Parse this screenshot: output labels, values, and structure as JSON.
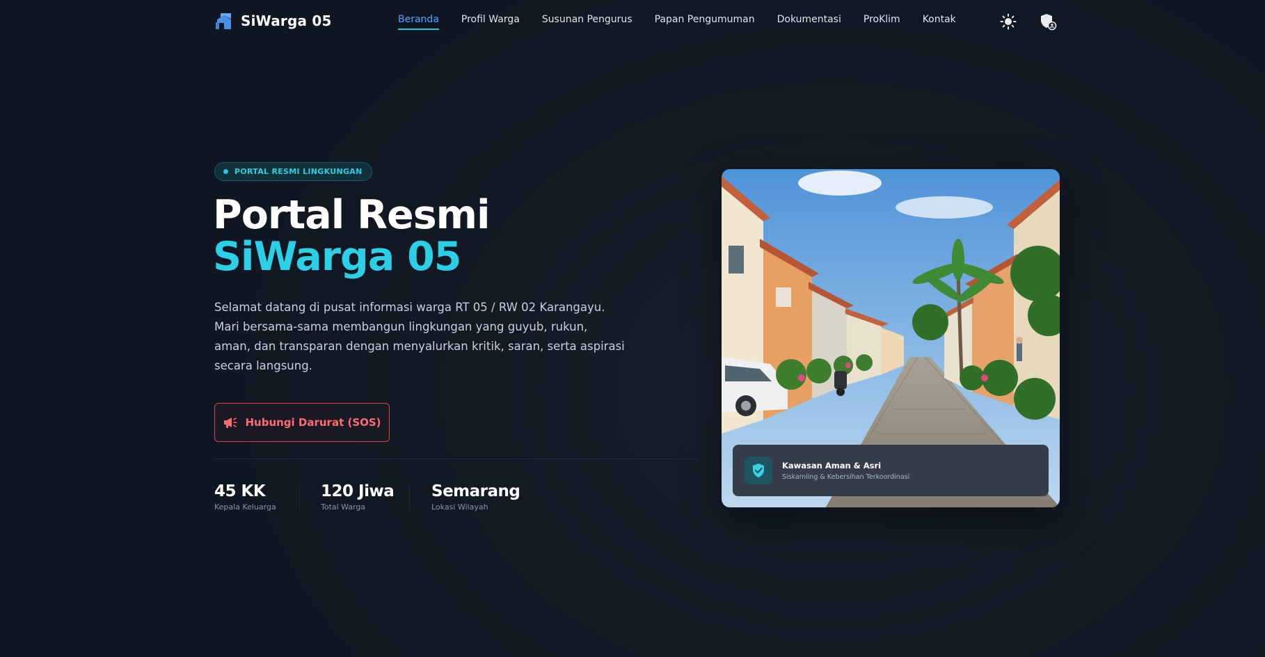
{
  "nav": {
    "brand": "SiWarga 05",
    "items": [
      {
        "label": "Beranda",
        "active": true
      },
      {
        "label": "Profil Warga",
        "active": false
      },
      {
        "label": "Susunan Pengurus",
        "active": false
      },
      {
        "label": "Papan Pengumuman",
        "active": false
      },
      {
        "label": "Dokumentasi",
        "active": false
      },
      {
        "label": "ProKlim",
        "active": false
      },
      {
        "label": "Kontak",
        "active": false
      }
    ],
    "icons": [
      "sun-icon",
      "shield-user-icon"
    ]
  },
  "hero": {
    "badge": "PORTAL RESMI LINGKUNGAN",
    "title_line1": "Portal Resmi",
    "title_line2": "SiWarga 05",
    "description": "Selamat datang di pusat informasi warga RT 05 / RW 02 Karangayu. Mari bersama-sama membangun lingkungan yang guyub, rukun, aman, dan transparan dengan menyalurkan kritik, saran, serta aspirasi secara langsung.",
    "sos_button": "Hubungi Darurat (SOS)",
    "stats": [
      {
        "value": "45 KK",
        "label": "Kepala Keluarga"
      },
      {
        "value": "120 Jiwa",
        "label": "Total Warga"
      },
      {
        "value": "Semarang",
        "label": "Lokasi Wilayah"
      }
    ],
    "card": {
      "title": "Kawasan Aman & Asri",
      "subtitle": "Siskamling & Kebersihan Terkoordinasi"
    }
  },
  "colors": {
    "accent": "#2cd0e6",
    "active_link": "#4da3ff",
    "danger": "#ff6b74",
    "background": "#131a24"
  }
}
